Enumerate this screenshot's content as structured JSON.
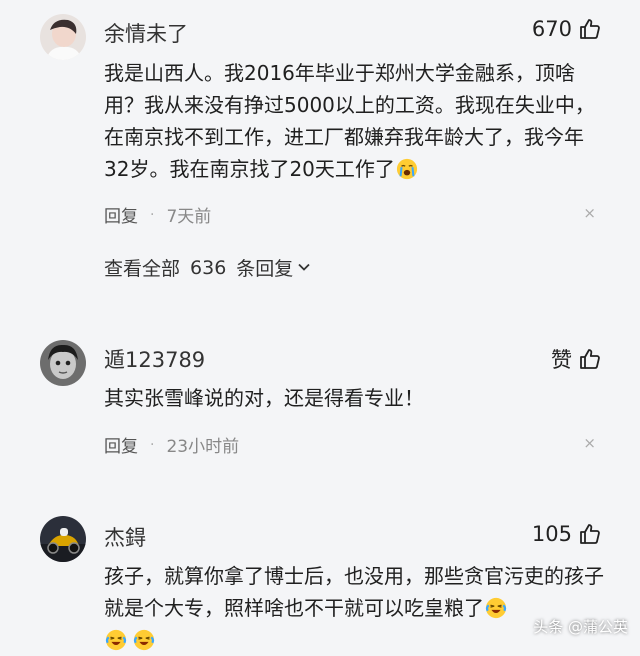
{
  "comments": [
    {
      "username": "余情未了",
      "likes": "670",
      "text": "我是山西人。我2016年毕业于郑州大学金融系，顶啥用？我从来没有挣过5000以上的工资。我现在失业中，在南京找不到工作，进工厂都嫌弃我年龄大了，我今年32岁。我在南京找了20天工作了",
      "reply_label": "回复",
      "time": "7天前",
      "close": "×",
      "view_all": {
        "prefix": "查看全部",
        "count": "636",
        "suffix": "条回复"
      }
    },
    {
      "username": "遁123789",
      "likes": "赞",
      "text": "其实张雪峰说的对，还是得看专业！",
      "reply_label": "回复",
      "time": "23小时前",
      "close": "×"
    },
    {
      "username": "杰鍀",
      "likes": "105",
      "text": "孩子，就算你拿了博士后，也没用，那些贪官污吏的孩子就是个大专，照样啥也不干就可以吃皇粮了"
    }
  ],
  "watermark": "头条 @蒲公英",
  "icons": {
    "like": "thumbs-up-icon",
    "cry": "crying-emoji-icon",
    "laugh": "laughing-crying-emoji-icon"
  },
  "colors": {
    "background": "#f4f5f7",
    "text": "#1f1f1f",
    "meta": "#888888"
  }
}
